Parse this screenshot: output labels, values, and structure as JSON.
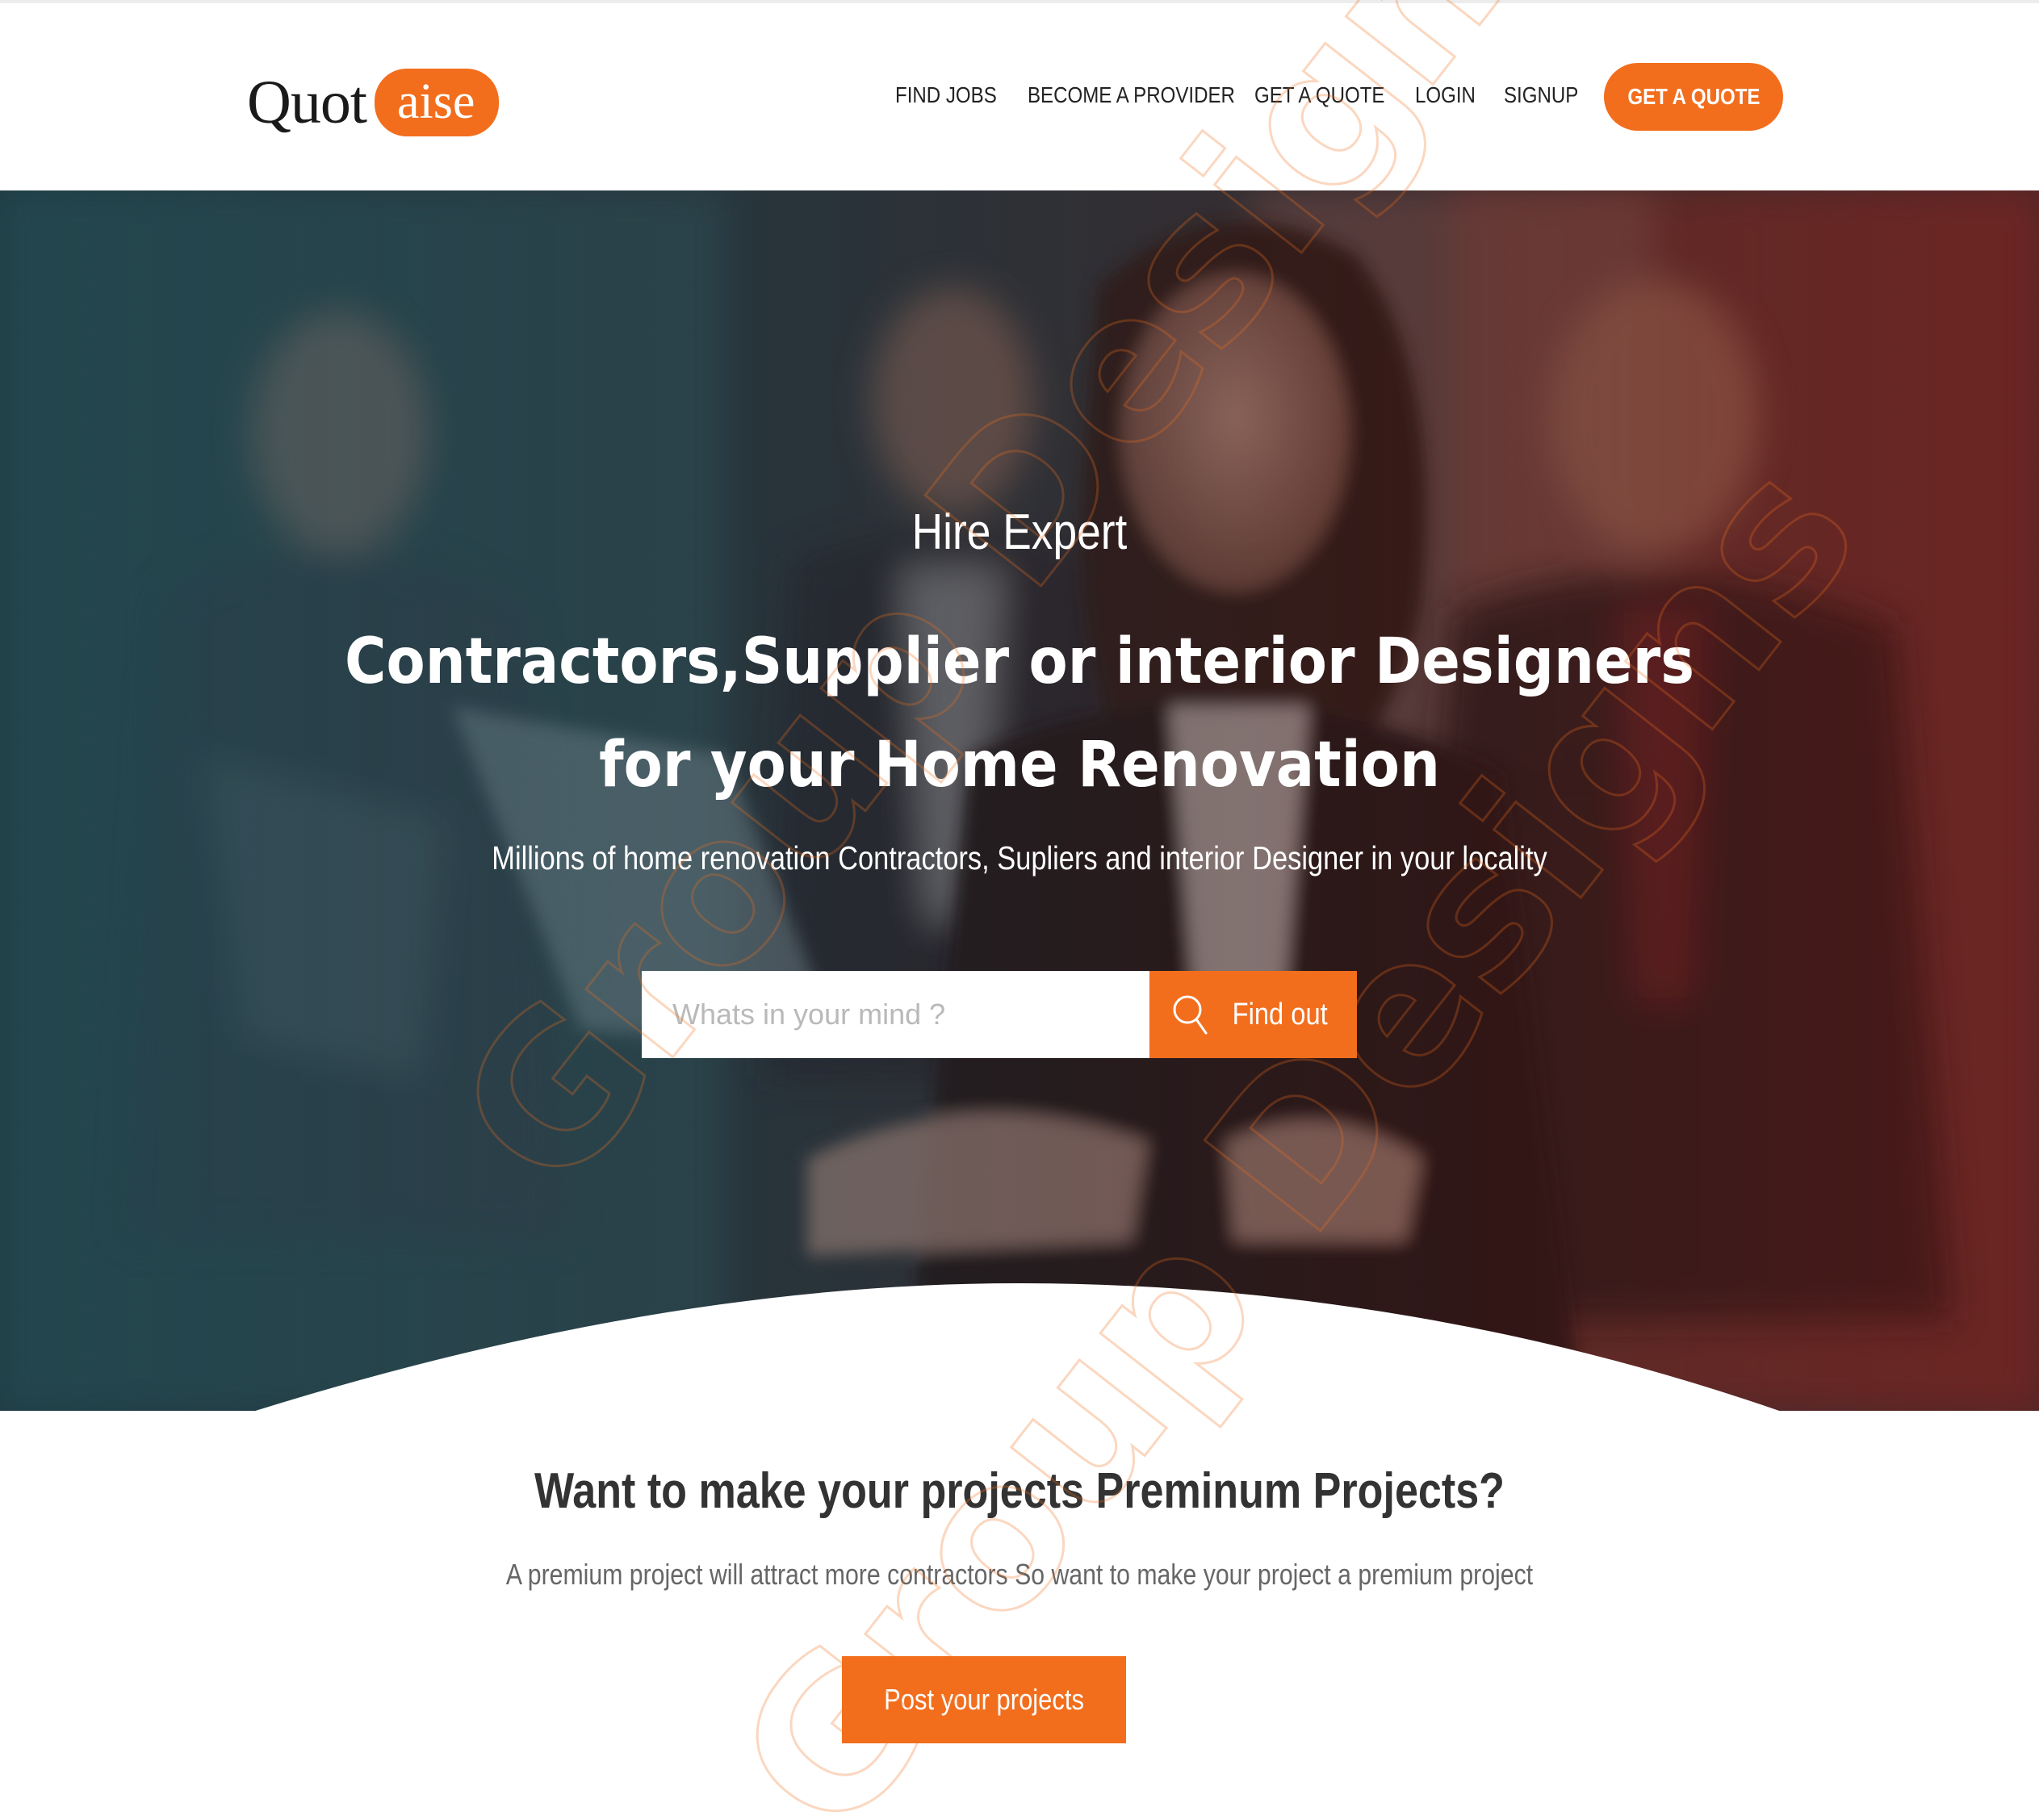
{
  "brand": {
    "logo_part1": "Quot",
    "logo_part2": "aise",
    "accent_color": "#f26e1d"
  },
  "nav": {
    "items": [
      {
        "label": "FIND JOBS"
      },
      {
        "label": "BECOME A PROVIDER"
      },
      {
        "label": "GET A QUOTE"
      },
      {
        "label": "LOGIN"
      },
      {
        "label": "SIGNUP"
      }
    ],
    "cta_label": "GET A QUOTE"
  },
  "hero": {
    "kicker": "Hire Expert",
    "title_line1": "Contractors,Supplier or interior Designers",
    "title_line2": "for your Home Renovation",
    "subtitle": "Millions of home renovation Contractors, Supliers and interior Designer in your locality",
    "search_placeholder": "Whats in your mind ?",
    "search_button_label": "Find out",
    "search_icon": "search-icon"
  },
  "premium": {
    "title": "Want to make your projects Preminum Projects?",
    "description": "A premium project will attract more contractors So want to make your project a premium project",
    "button_label": "Post your projects"
  },
  "watermark": {
    "text_1": "Group Designs",
    "text_2": "Group Designs"
  }
}
